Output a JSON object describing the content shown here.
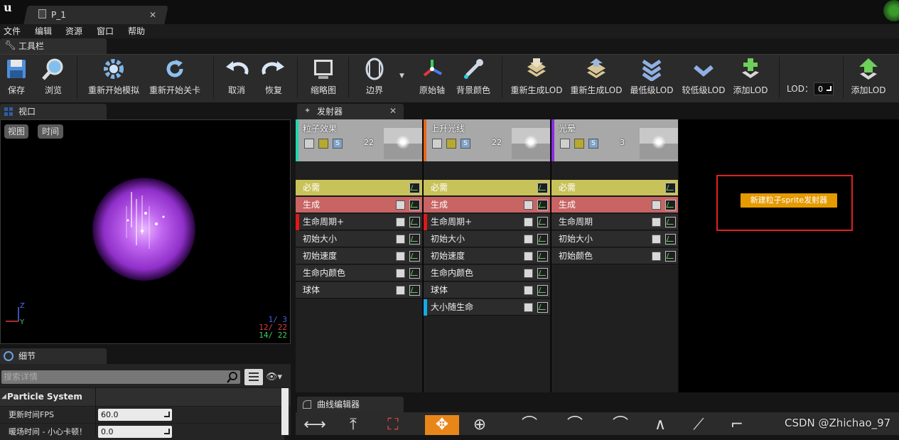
{
  "window": {
    "doc_tab_title": "P_1"
  },
  "menu": [
    "文件",
    "编辑",
    "资源",
    "窗口",
    "帮助"
  ],
  "toolbar_tab": "工具栏",
  "toolbar": {
    "save": "保存",
    "browse": "浏览",
    "restart_sim": "重新开始模拟",
    "restart_level": "重新开始关卡",
    "undo": "取消",
    "redo": "恢复",
    "thumbnail": "缩略图",
    "bounds": "边界",
    "origin_axis": "原始轴",
    "bg_color": "背景颜色",
    "regen_lod_1": "重新生成LOD",
    "regen_lod_2": "重新生成LOD",
    "lowest_lod": "最低级LOD",
    "lower_lod": "较低级LOD",
    "add_lod": "添加LOD",
    "lod_label": "LOD：",
    "lod_value": "0",
    "add_lod_2": "添加LOD"
  },
  "viewport": {
    "tab": "视口",
    "view_btn": "视图",
    "time_btn": "时间",
    "axis_z": "Z",
    "axis_y": "Y",
    "stats": [
      {
        "text": "1/  3",
        "color": "#4a5ee8"
      },
      {
        "text": "12/  22",
        "color": "#e03a3a"
      },
      {
        "text": "14/  22",
        "color": "#3ad05a"
      }
    ]
  },
  "details": {
    "tab": "细节",
    "search_placeholder": "搜索详情",
    "category": "Particle System",
    "props": [
      {
        "label": "更新时间FPS",
        "value": "60.0"
      },
      {
        "label": "暖场时间 - 小心卡顿！",
        "value": "0.0"
      }
    ]
  },
  "emitters_panel": {
    "tab": "发射器",
    "context_button": "新建粒子sprite发射器",
    "columns": [
      {
        "name": "粒子效果",
        "count": "22",
        "stripe": "#1fd7b0",
        "modules": [
          {
            "label": "必需",
            "kind": "req"
          },
          {
            "label": "生成",
            "kind": "spawn"
          },
          {
            "label": "生命周期+",
            "kind": "norm",
            "bar": "#e01818"
          },
          {
            "label": "初始大小",
            "kind": "norm"
          },
          {
            "label": "初始速度",
            "kind": "norm"
          },
          {
            "label": "生命内颜色",
            "kind": "norm"
          },
          {
            "label": "球体",
            "kind": "norm"
          }
        ]
      },
      {
        "name": "上升光线",
        "count": "22",
        "stripe": "#e8661a",
        "modules": [
          {
            "label": "必需",
            "kind": "req"
          },
          {
            "label": "生成",
            "kind": "spawn"
          },
          {
            "label": "生命周期+",
            "kind": "norm",
            "bar": "#e01818"
          },
          {
            "label": "初始大小",
            "kind": "norm"
          },
          {
            "label": "初始速度",
            "kind": "norm"
          },
          {
            "label": "生命内颜色",
            "kind": "norm"
          },
          {
            "label": "球体",
            "kind": "norm"
          },
          {
            "label": "大小随生命",
            "kind": "norm",
            "bar": "#18a8e8"
          }
        ]
      },
      {
        "name": "光晕",
        "count": "3",
        "stripe": "#8a2be2",
        "modules": [
          {
            "label": "必需",
            "kind": "req"
          },
          {
            "label": "生成",
            "kind": "spawn"
          },
          {
            "label": "生命周期",
            "kind": "norm"
          },
          {
            "label": "初始大小",
            "kind": "norm"
          },
          {
            "label": "初始颜色",
            "kind": "norm"
          }
        ]
      }
    ]
  },
  "curve_editor": {
    "tab": "曲线编辑器"
  },
  "watermark": "CSDN @Zhichao_97"
}
